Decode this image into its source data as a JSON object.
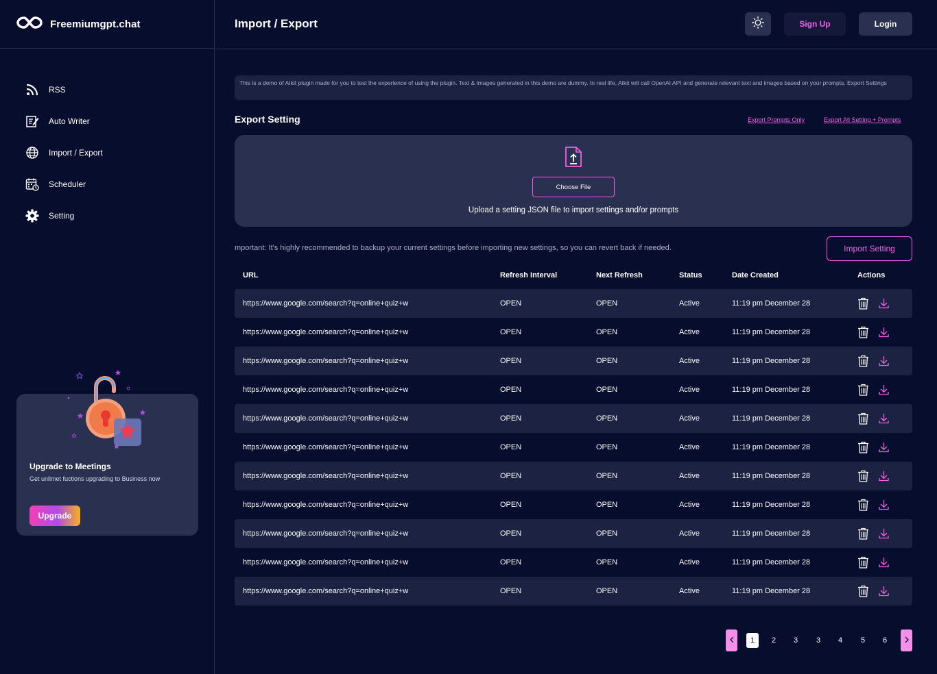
{
  "brand": {
    "name": "Freemiumgpt.chat"
  },
  "sidebar": {
    "items": [
      {
        "label": "RSS",
        "icon": "rss-icon"
      },
      {
        "label": "Auto Writer",
        "icon": "edit-document-icon"
      },
      {
        "label": "Import / Export",
        "icon": "globe-icon"
      },
      {
        "label": "Scheduler",
        "icon": "calendar-clock-icon"
      },
      {
        "label": "Setting",
        "icon": "gear-icon"
      }
    ],
    "upgrade": {
      "title": "Upgrade to Meetings",
      "subtitle": "Get unlimet fuctions upgrading to Business now",
      "button": "Upgrade"
    }
  },
  "header": {
    "title": "Import / Export",
    "theme_icon": "sun-icon",
    "signup": "Sign Up",
    "login": "Login"
  },
  "main": {
    "notice": "This is a demo of AIkit plugin made for you to test the experience of using the plugin. Text & images generated in this demo are dummy. In real life, AIkit will call OpenAI API and generate relevant text and images based on your prompts. Export Settings",
    "section_title": "Export Setting",
    "export_prompts_link": "Export Prompts Only",
    "export_all_link": "Export All Setting + Prompts",
    "choose_file": "Choose File",
    "upload_text": "Upload a setting JSON file to import settings and/or prompts",
    "important": "mportant: It's highly recommended to backup your current settings before importing new settings, so you can revert back if needed.",
    "import_button": "Import Setting"
  },
  "table": {
    "headers": {
      "url": "URL",
      "interval": "Refresh Interval",
      "next": "Next Refresh",
      "status": "Status",
      "date": "Date Created",
      "actions": "Actions"
    },
    "rows": [
      {
        "url": "https://www.google.com/search?q=online+quiz+w",
        "interval": "OPEN",
        "next": "OPEN",
        "status": "Active",
        "date": "11:19 pm December 28"
      },
      {
        "url": "https://www.google.com/search?q=online+quiz+w",
        "interval": "OPEN",
        "next": "OPEN",
        "status": "Active",
        "date": "11:19 pm December 28"
      },
      {
        "url": "https://www.google.com/search?q=online+quiz+w",
        "interval": "OPEN",
        "next": "OPEN",
        "status": "Active",
        "date": "11:19 pm December 28"
      },
      {
        "url": "https://www.google.com/search?q=online+quiz+w",
        "interval": "OPEN",
        "next": "OPEN",
        "status": "Active",
        "date": "11:19 pm December 28"
      },
      {
        "url": "https://www.google.com/search?q=online+quiz+w",
        "interval": "OPEN",
        "next": "OPEN",
        "status": "Active",
        "date": "11:19 pm December 28"
      },
      {
        "url": "https://www.google.com/search?q=online+quiz+w",
        "interval": "OPEN",
        "next": "OPEN",
        "status": "Active",
        "date": "11:19 pm December 28"
      },
      {
        "url": "https://www.google.com/search?q=online+quiz+w",
        "interval": "OPEN",
        "next": "OPEN",
        "status": "Active",
        "date": "11:19 pm December 28"
      },
      {
        "url": "https://www.google.com/search?q=online+quiz+w",
        "interval": "OPEN",
        "next": "OPEN",
        "status": "Active",
        "date": "11:19 pm December 28"
      },
      {
        "url": "https://www.google.com/search?q=online+quiz+w",
        "interval": "OPEN",
        "next": "OPEN",
        "status": "Active",
        "date": "11:19 pm December 28"
      },
      {
        "url": "https://www.google.com/search?q=online+quiz+w",
        "interval": "OPEN",
        "next": "OPEN",
        "status": "Active",
        "date": "11:19 pm December 28"
      },
      {
        "url": "https://www.google.com/search?q=online+quiz+w",
        "interval": "OPEN",
        "next": "OPEN",
        "status": "Active",
        "date": "11:19 pm December 28"
      }
    ]
  },
  "pagination": {
    "pages": [
      "1",
      "2",
      "3",
      "3",
      "4",
      "5",
      "6"
    ],
    "current": "1"
  },
  "colors": {
    "background": "#070d2d",
    "panel": "#2a3150",
    "accent": "#f061e6",
    "row": "#1b2242"
  }
}
